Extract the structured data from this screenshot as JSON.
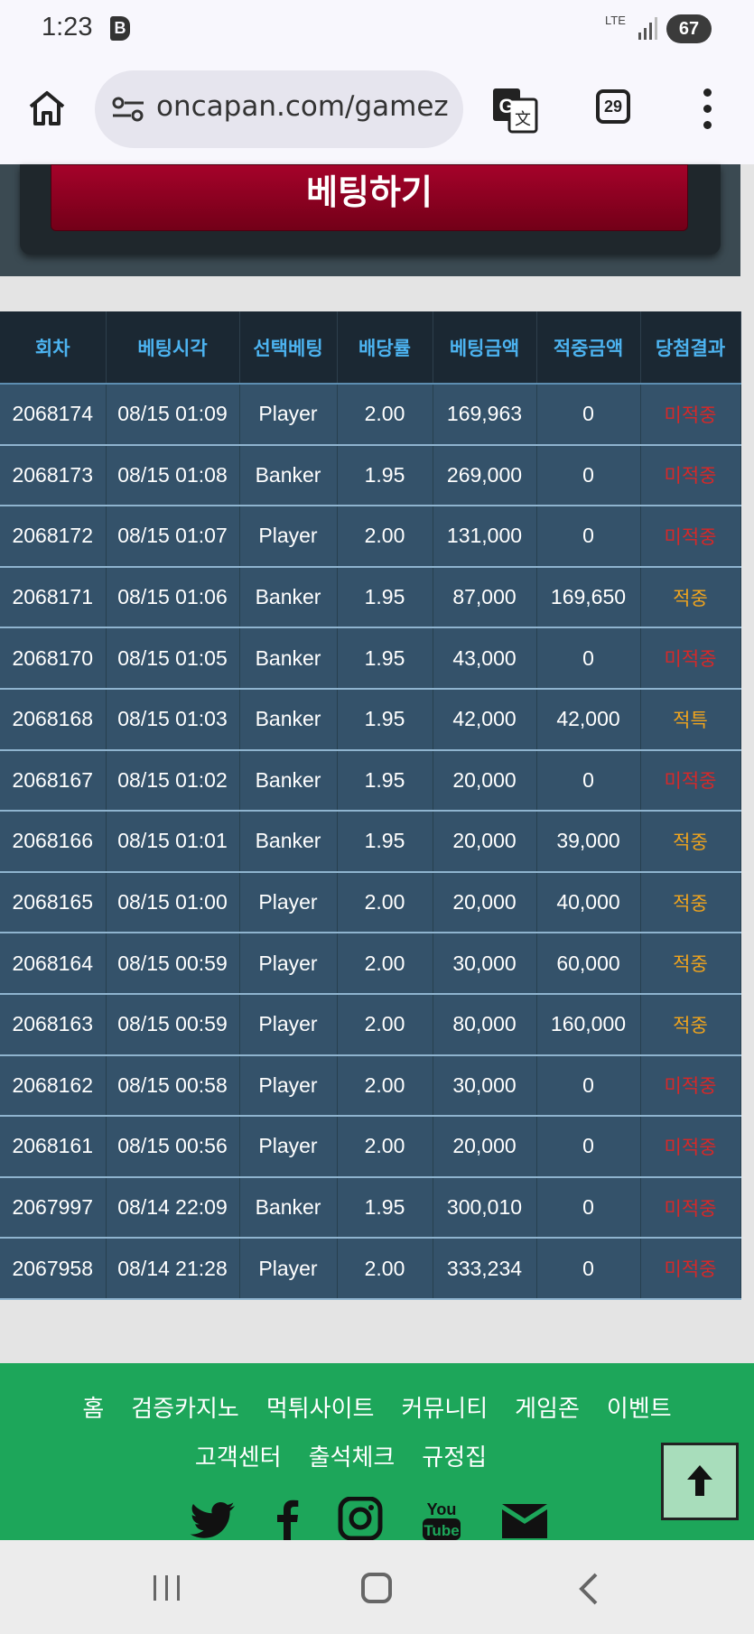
{
  "status_bar": {
    "time": "1:23",
    "app_badge": "B",
    "network": "LTE",
    "battery": "67"
  },
  "browser": {
    "url": "oncapan.com/gamez",
    "tab_count": "29"
  },
  "bet_button_label": "베팅하기",
  "table": {
    "headers": [
      "회차",
      "베팅시각",
      "선택베팅",
      "배당률",
      "베팅금액",
      "적중금액",
      "당첨결과"
    ],
    "rows": [
      [
        "2068174",
        "08/15 01:09",
        "Player",
        "2.00",
        "169,963",
        "0",
        "미적중"
      ],
      [
        "2068173",
        "08/15 01:08",
        "Banker",
        "1.95",
        "269,000",
        "0",
        "미적중"
      ],
      [
        "2068172",
        "08/15 01:07",
        "Player",
        "2.00",
        "131,000",
        "0",
        "미적중"
      ],
      [
        "2068171",
        "08/15 01:06",
        "Banker",
        "1.95",
        "87,000",
        "169,650",
        "적중"
      ],
      [
        "2068170",
        "08/15 01:05",
        "Banker",
        "1.95",
        "43,000",
        "0",
        "미적중"
      ],
      [
        "2068168",
        "08/15 01:03",
        "Banker",
        "1.95",
        "42,000",
        "42,000",
        "적특"
      ],
      [
        "2068167",
        "08/15 01:02",
        "Banker",
        "1.95",
        "20,000",
        "0",
        "미적중"
      ],
      [
        "2068166",
        "08/15 01:01",
        "Banker",
        "1.95",
        "20,000",
        "39,000",
        "적중"
      ],
      [
        "2068165",
        "08/15 01:00",
        "Player",
        "2.00",
        "20,000",
        "40,000",
        "적중"
      ],
      [
        "2068164",
        "08/15 00:59",
        "Player",
        "2.00",
        "30,000",
        "60,000",
        "적중"
      ],
      [
        "2068163",
        "08/15 00:59",
        "Player",
        "2.00",
        "80,000",
        "160,000",
        "적중"
      ],
      [
        "2068162",
        "08/15 00:58",
        "Player",
        "2.00",
        "30,000",
        "0",
        "미적중"
      ],
      [
        "2068161",
        "08/15 00:56",
        "Player",
        "2.00",
        "20,000",
        "0",
        "미적중"
      ],
      [
        "2067997",
        "08/14 22:09",
        "Banker",
        "1.95",
        "300,010",
        "0",
        "미적중"
      ],
      [
        "2067958",
        "08/14 21:28",
        "Player",
        "2.00",
        "333,234",
        "0",
        "미적중"
      ]
    ]
  },
  "footer": {
    "links_row1": [
      "홈",
      "검증카지노",
      "먹튀사이트",
      "커뮤니티",
      "게임존",
      "이벤트"
    ],
    "links_row2": [
      "고객센터",
      "출석체크",
      "규정집"
    ],
    "social_icons": [
      "twitter-icon",
      "facebook-icon",
      "instagram-icon",
      "youtube-icon",
      "email-icon"
    ],
    "youtube_text": [
      "You",
      "Tube"
    ]
  },
  "colors": {
    "footer_green": "#1da65a",
    "bet_red": "#a5022a",
    "header_blue_text": "#4cb3f0",
    "row_bg": "#34526a",
    "lose_red": "#d72828",
    "win_orange": "#f0a41d"
  }
}
